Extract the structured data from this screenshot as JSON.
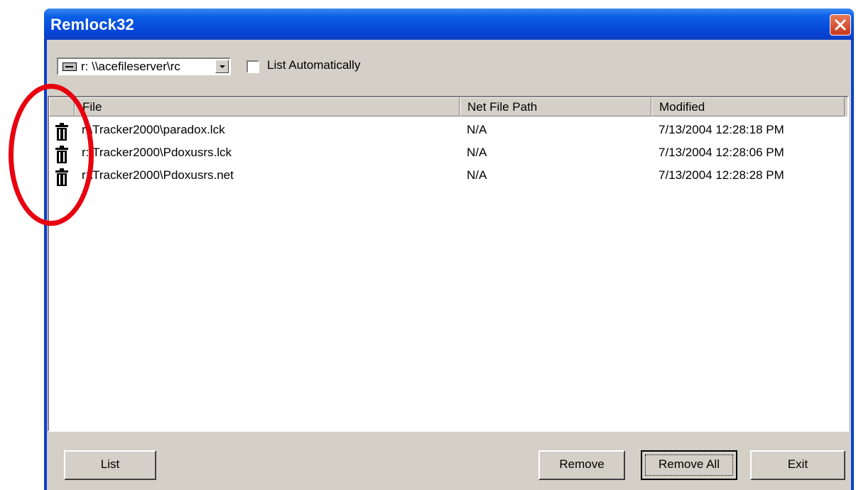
{
  "window": {
    "title": "Remlock32"
  },
  "toolbar": {
    "drive_value": "r: \\\\acefileserver\\rc",
    "auto_list_label": "List Automatically"
  },
  "list": {
    "columns": [
      "File",
      "Net File Path",
      "Modified"
    ],
    "rows": [
      {
        "icon": "trash-icon",
        "file": "r:\\Tracker2000\\paradox.lck",
        "net_path": "N/A",
        "modified": "7/13/2004 12:28:18 PM"
      },
      {
        "icon": "trash-icon",
        "file": "r:\\Tracker2000\\Pdoxusrs.lck",
        "net_path": "N/A",
        "modified": "7/13/2004 12:28:06 PM"
      },
      {
        "icon": "trash-icon",
        "file": "r:\\Tracker2000\\Pdoxusrs.net",
        "net_path": "N/A",
        "modified": "7/13/2004 12:28:28 PM"
      }
    ]
  },
  "buttons": {
    "list": "List",
    "remove": "Remove",
    "remove_all": "Remove All",
    "exit": "Exit"
  },
  "annotation": {
    "color": "#e8000f",
    "shape": "circle"
  }
}
